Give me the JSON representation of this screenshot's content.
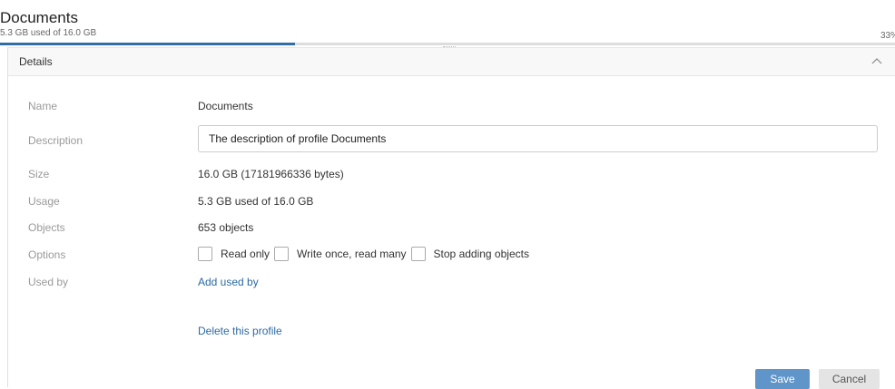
{
  "header": {
    "title": "Documents",
    "subtitle": "5.3 GB used of 16.0 GB",
    "usage_percent_label": "33%",
    "usage_fraction": 0.33,
    "accent_color": "#2f6ea6"
  },
  "details": {
    "title": "Details",
    "collapse_icon": "chevron-up-icon",
    "fields": {
      "name": {
        "label": "Name",
        "value": "Documents"
      },
      "description": {
        "label": "Description",
        "value": "The description of profile Documents"
      },
      "size": {
        "label": "Size",
        "value": "16.0 GB (17181966336 bytes)"
      },
      "usage": {
        "label": "Usage",
        "value": "5.3 GB used of 16.0 GB"
      },
      "objects": {
        "label": "Objects",
        "value": "653 objects"
      },
      "options": {
        "label": "Options",
        "items": [
          {
            "label": "Read only",
            "checked": false
          },
          {
            "label": "Write once, read many",
            "checked": false
          },
          {
            "label": "Stop adding objects",
            "checked": false
          }
        ]
      },
      "used_by": {
        "label": "Used by",
        "link": "Add used by"
      }
    },
    "delete_link": "Delete this profile",
    "buttons": {
      "save": "Save",
      "cancel": "Cancel"
    }
  }
}
